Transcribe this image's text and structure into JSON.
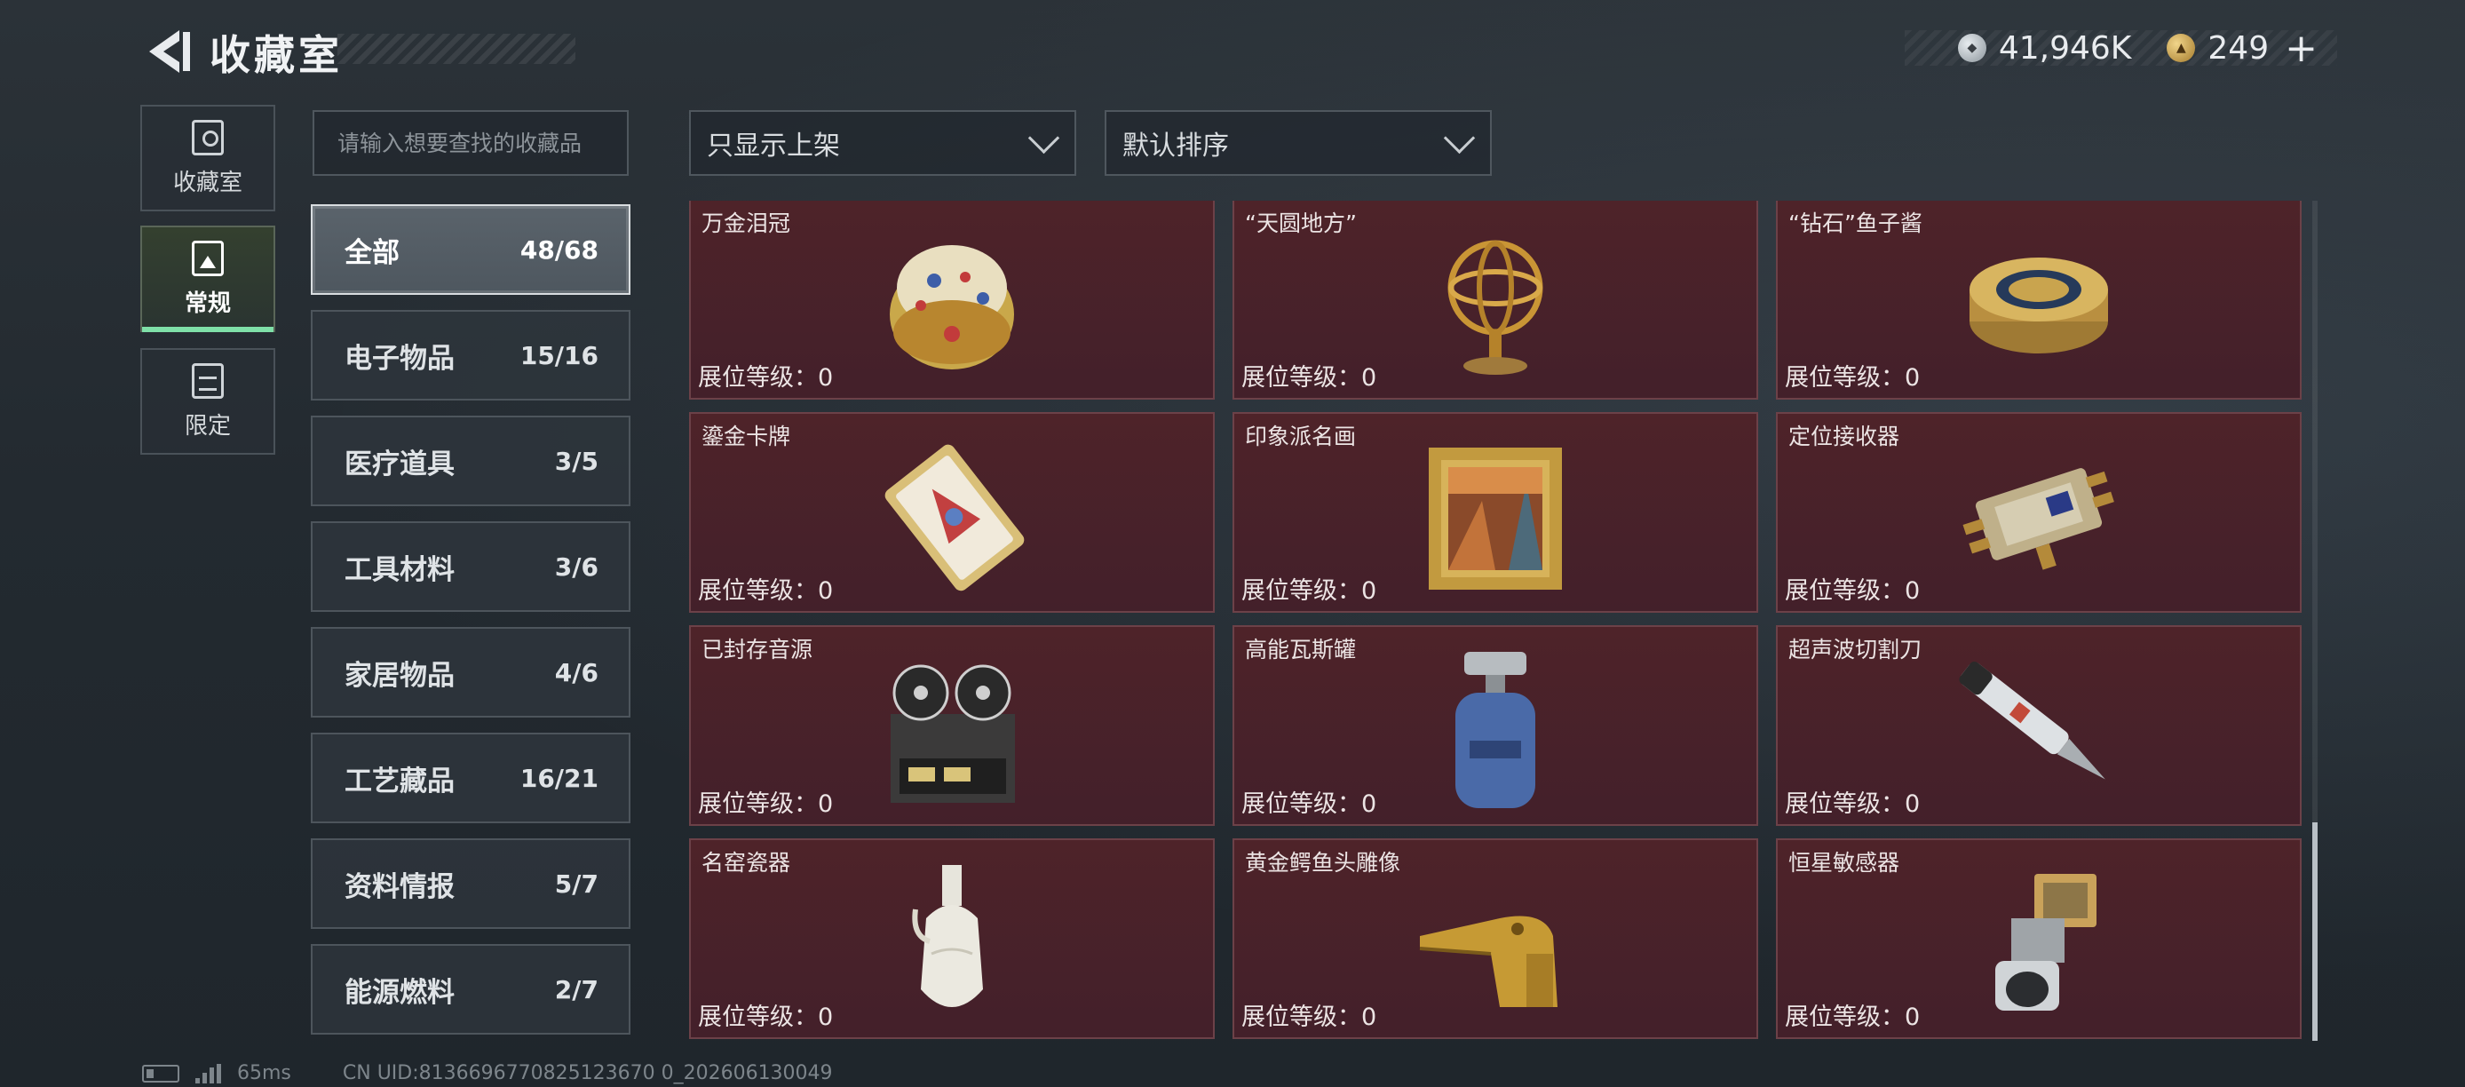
{
  "header": {
    "title": "收藏室",
    "silver_value": "41,946K",
    "gold_value": "249",
    "gold_add": "+"
  },
  "side_tabs": [
    {
      "label": "收藏室",
      "icon": "collection-room-icon"
    },
    {
      "label": "常规",
      "icon": "regular-icon"
    },
    {
      "label": "限定",
      "icon": "limited-icon"
    }
  ],
  "search": {
    "placeholder": "请输入想要查找的收藏品"
  },
  "filters": {
    "shelf": "只显示上架",
    "sort": "默认排序"
  },
  "categories": [
    {
      "label": "全部",
      "count": "48/68"
    },
    {
      "label": "电子物品",
      "count": "15/16"
    },
    {
      "label": "医疗道具",
      "count": "3/5"
    },
    {
      "label": "工具材料",
      "count": "3/6"
    },
    {
      "label": "家居物品",
      "count": "4/6"
    },
    {
      "label": "工艺藏品",
      "count": "16/21"
    },
    {
      "label": "资料情报",
      "count": "5/7"
    },
    {
      "label": "能源燃料",
      "count": "2/7"
    }
  ],
  "items": [
    {
      "name": "万金泪冠",
      "level": "展位等级：0",
      "icon": "jeweled-egg-icon"
    },
    {
      "name": "“天圆地方”",
      "level": "展位等级：0",
      "icon": "armillary-sphere-icon"
    },
    {
      "name": "“钻石”鱼子酱",
      "level": "展位等级：0",
      "icon": "caviar-tin-icon"
    },
    {
      "name": "鎏金卡牌",
      "level": "展位等级：0",
      "icon": "gilded-card-icon"
    },
    {
      "name": "印象派名画",
      "level": "展位等级：0",
      "icon": "framed-painting-icon"
    },
    {
      "name": "定位接收器",
      "level": "展位等级：0",
      "icon": "gps-receiver-icon"
    },
    {
      "name": "已封存音源",
      "level": "展位等级：0",
      "icon": "reel-tape-recorder-icon"
    },
    {
      "name": "高能瓦斯罐",
      "level": "展位等级：0",
      "icon": "gas-canister-icon"
    },
    {
      "name": "超声波切割刀",
      "level": "展位等级：0",
      "icon": "ultrasonic-cutter-icon"
    },
    {
      "name": "名窑瓷器",
      "level": "展位等级：0",
      "icon": "porcelain-vase-icon"
    },
    {
      "name": "黄金鳄鱼头雕像",
      "level": "展位等级：0",
      "icon": "golden-crocodile-head-icon"
    },
    {
      "name": "恒星敏感器",
      "level": "展位等级：0",
      "icon": "star-sensor-icon"
    }
  ],
  "status": {
    "ping": "65ms",
    "uid": "CN UID:8136696770825123670 0_202606130049"
  }
}
